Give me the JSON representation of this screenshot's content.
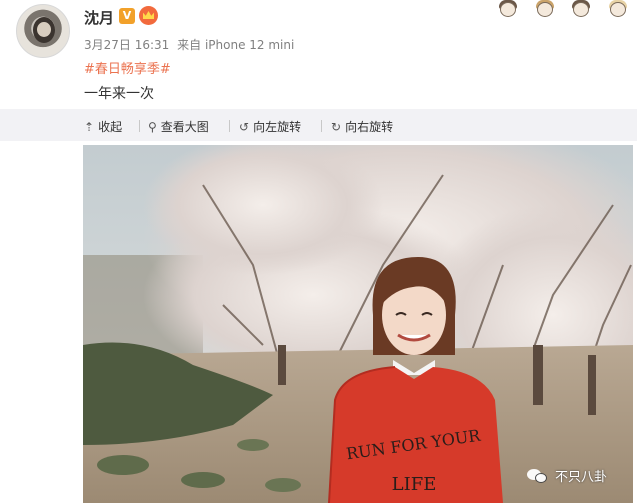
{
  "post": {
    "username": "沈月",
    "verified_badge": "V",
    "date": "3月27日 16:31",
    "source": "来自 iPhone 12 mini",
    "hashtag": "#春日畅享季#",
    "text": "一年来一次"
  },
  "toolbar": {
    "collapse": {
      "icon": "up-arrow-icon",
      "label": "收起"
    },
    "view_large": {
      "icon": "search-icon",
      "label": "查看大图"
    },
    "rotate_left": {
      "icon": "rotate-left-icon",
      "label": "向左旋转"
    },
    "rotate_right": {
      "icon": "rotate-right-icon",
      "label": "向右旋转"
    }
  },
  "photo": {
    "sweater_text_line1": "RUN FOR YOUR",
    "sweater_text_line2": "LIFE"
  },
  "watermark": {
    "text": "不只八卦"
  },
  "colors": {
    "hashtag": "#eb7350",
    "toolbar_bg": "#f2f2f5",
    "badge_v": "#f2a12a",
    "sweater": "#d63a2a"
  }
}
